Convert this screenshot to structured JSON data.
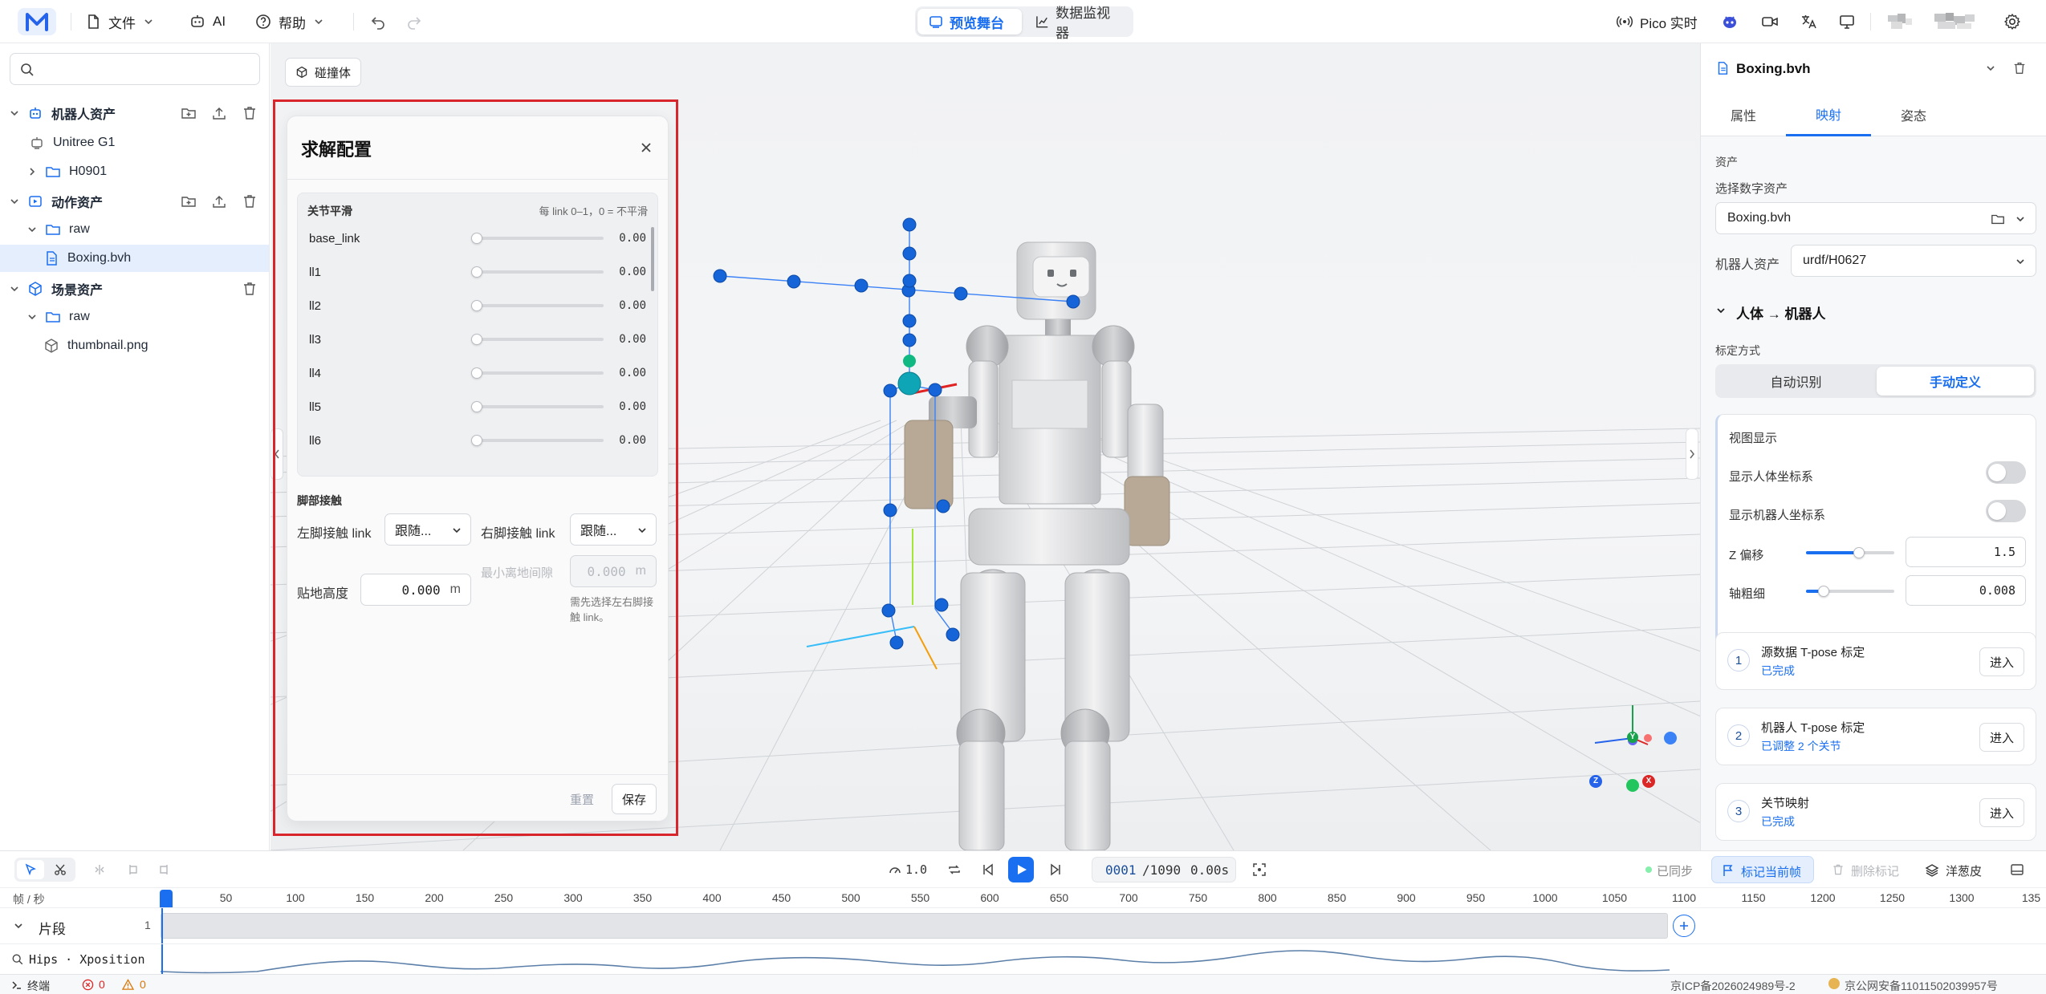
{
  "topbar": {
    "menu_file": "文件",
    "menu_ai": "AI",
    "menu_help": "帮助",
    "tab_preview": "预览舞台",
    "tab_monitor": "数据监视器",
    "pico_label": "Pico 实时"
  },
  "left": {
    "search_placeholder": "",
    "robot_assets": "机器人资产",
    "robot_items": [
      "Unitree G1",
      "H0901"
    ],
    "motion_assets": "动作资产",
    "motion_folder": "raw",
    "motion_file": "Boxing.bvh",
    "scene_assets": "场景资产",
    "scene_folder": "raw",
    "scene_file": "thumbnail.png"
  },
  "viewport": {
    "collide_label": "碰撞体",
    "axes": {
      "y": "Y",
      "x": "X",
      "z": "Z"
    }
  },
  "dialog": {
    "title": "求解配置",
    "smooth_title": "关节平滑",
    "smooth_hint": "每 link 0–1，0 = 不平滑",
    "joints": [
      {
        "name": "base_link",
        "value": "0.00"
      },
      {
        "name": "ll1",
        "value": "0.00"
      },
      {
        "name": "ll2",
        "value": "0.00"
      },
      {
        "name": "ll3",
        "value": "0.00"
      },
      {
        "name": "ll4",
        "value": "0.00"
      },
      {
        "name": "ll5",
        "value": "0.00"
      },
      {
        "name": "ll6",
        "value": "0.00"
      }
    ],
    "foot_title": "脚部接触",
    "left_foot_label": "左脚接触 link",
    "left_foot_value": "跟随...",
    "right_foot_label": "右脚接触 link",
    "right_foot_value": "跟随...",
    "ground_label": "贴地高度",
    "ground_value": "0.000",
    "ground_unit": "m",
    "min_gap_label": "最小离地间隙",
    "min_gap_value": "0.000",
    "min_gap_unit": "m",
    "min_gap_hint": "需先选择左右脚接触 link。",
    "reset_label": "重置",
    "save_label": "保存"
  },
  "right": {
    "file_title": "Boxing.bvh",
    "tabs": [
      "属性",
      "映射",
      "姿态"
    ],
    "asset_section": "资产",
    "select_digital": "选择数字资产",
    "digital_value": "Boxing.bvh",
    "robot_asset_label": "机器人资产",
    "robot_asset_value": "urdf/H0627",
    "mapping_title": "人体 → 机器人",
    "calib_label": "标定方式",
    "calib_auto": "自动识别",
    "calib_manual": "手动定义",
    "view_title": "视图显示",
    "show_human_axes": "显示人体坐标系",
    "show_robot_axes": "显示机器人坐标系",
    "z_offset_label": "Z 偏移",
    "z_offset_value": "1.5",
    "z_offset_level": 0.6,
    "axis_width_label": "轴粗细",
    "axis_width_value": "0.008",
    "axis_width_level": 0.2,
    "steps": [
      {
        "num": "1",
        "title": "源数据 T-pose 标定",
        "status": "已完成",
        "action": "进入"
      },
      {
        "num": "2",
        "title": "机器人 T-pose 标定",
        "status": "已调整 2 个关节",
        "action": "进入"
      },
      {
        "num": "3",
        "title": "关节映射",
        "status": "已完成",
        "action": "进入"
      }
    ]
  },
  "timeline": {
    "speed": "1.0",
    "frame_current": "0001",
    "frame_total": "/1090",
    "time": "0.00s",
    "synced": "已同步",
    "mark_frame": "标记当前帧",
    "delete_mark": "删除标记",
    "onion": "洋葱皮",
    "unit_label": "帧 / 秒",
    "ticks": [
      "50",
      "100",
      "150",
      "200",
      "250",
      "300",
      "350",
      "400",
      "450",
      "500",
      "550",
      "600",
      "650",
      "700",
      "750",
      "800",
      "850",
      "900",
      "950",
      "1000",
      "1050",
      "1100",
      "1150",
      "1200",
      "1250",
      "1300",
      "135"
    ],
    "segment_label": "片段",
    "segment_num": "1",
    "curve_label": "Hips · Xposition"
  },
  "status": {
    "terminal": "终端",
    "errors": "0",
    "warnings": "0",
    "icp": "京ICP备2026024989号-2",
    "police": "京公网安备11011502039957号"
  },
  "colors": {
    "accent": "#1a6ff0",
    "highlight_frame": "#d9262c",
    "skeleton_joint": "#1565d8",
    "skeleton_line": "#3b82f6"
  }
}
